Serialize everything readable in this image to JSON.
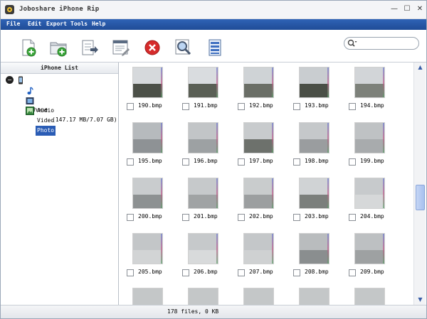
{
  "window": {
    "title": "Joboshare iPhone Rip"
  },
  "window_controls": {
    "minimize": "—",
    "maximize": "☐",
    "close": "✕"
  },
  "menu": [
    "File",
    "Edit",
    "Export",
    "Tools",
    "Help"
  ],
  "toolbar": {
    "icons": [
      "add-file-icon",
      "add-folder-icon",
      "export-icon",
      "edit-list-icon",
      "delete-icon",
      "preview-icon",
      "list-view-icon"
    ],
    "search_placeholder": ""
  },
  "left_panel": {
    "header": "iPhone List",
    "tree": {
      "device": "iPhone",
      "capacity": "(147.17 MB/7.07 GB)",
      "children": [
        "Audio",
        "Video",
        "Photo"
      ],
      "selected": "Photo"
    }
  },
  "photos": [
    "190.bmp",
    "191.bmp",
    "192.bmp",
    "193.bmp",
    "194.bmp",
    "195.bmp",
    "196.bmp",
    "197.bmp",
    "198.bmp",
    "199.bmp",
    "200.bmp",
    "201.bmp",
    "202.bmp",
    "203.bmp",
    "204.bmp",
    "205.bmp",
    "206.bmp",
    "207.bmp",
    "208.bmp",
    "209.bmp"
  ],
  "scroll": {
    "up_arrow": "▲",
    "down_arrow": "▼"
  },
  "status": {
    "text": "178 files, 0 KB"
  }
}
